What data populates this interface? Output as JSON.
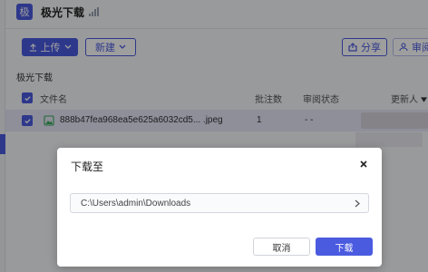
{
  "app": {
    "badge": "极",
    "title": "极光下载"
  },
  "toolbar": {
    "upload_label": "上传",
    "new_label": "新建",
    "share_label": "分享",
    "review_label": "审阅"
  },
  "section": {
    "label": "极光下载"
  },
  "table": {
    "headers": {
      "name": "文件名",
      "annotations": "批注数",
      "review_status": "审阅状态",
      "updater": "更新人"
    },
    "rows": [
      {
        "name": "888b47fea968ea5e625a6032cd5... .jpeg",
        "annotations": "1",
        "review_status": "- -"
      }
    ]
  },
  "dialog": {
    "title": "下载至",
    "path": "C:\\Users\\admin\\Downloads",
    "cancel_label": "取消",
    "confirm_label": "下载"
  },
  "colors": {
    "accent": "#4b5be0",
    "row_selected": "#e6e7f7",
    "overlay": "rgba(0,0,0,0.38)"
  },
  "icons": {
    "app": "app-badge",
    "network": "signal-icon",
    "upload": "upload-icon",
    "dropdown": "chevron-down-icon",
    "share": "share-icon",
    "review": "user-icon",
    "file_type": "image-file-icon",
    "close": "close-icon",
    "path_expand": "chevron-right-icon",
    "checkbox": "checkbox-checked-icon",
    "sort": "sort-down-icon"
  }
}
